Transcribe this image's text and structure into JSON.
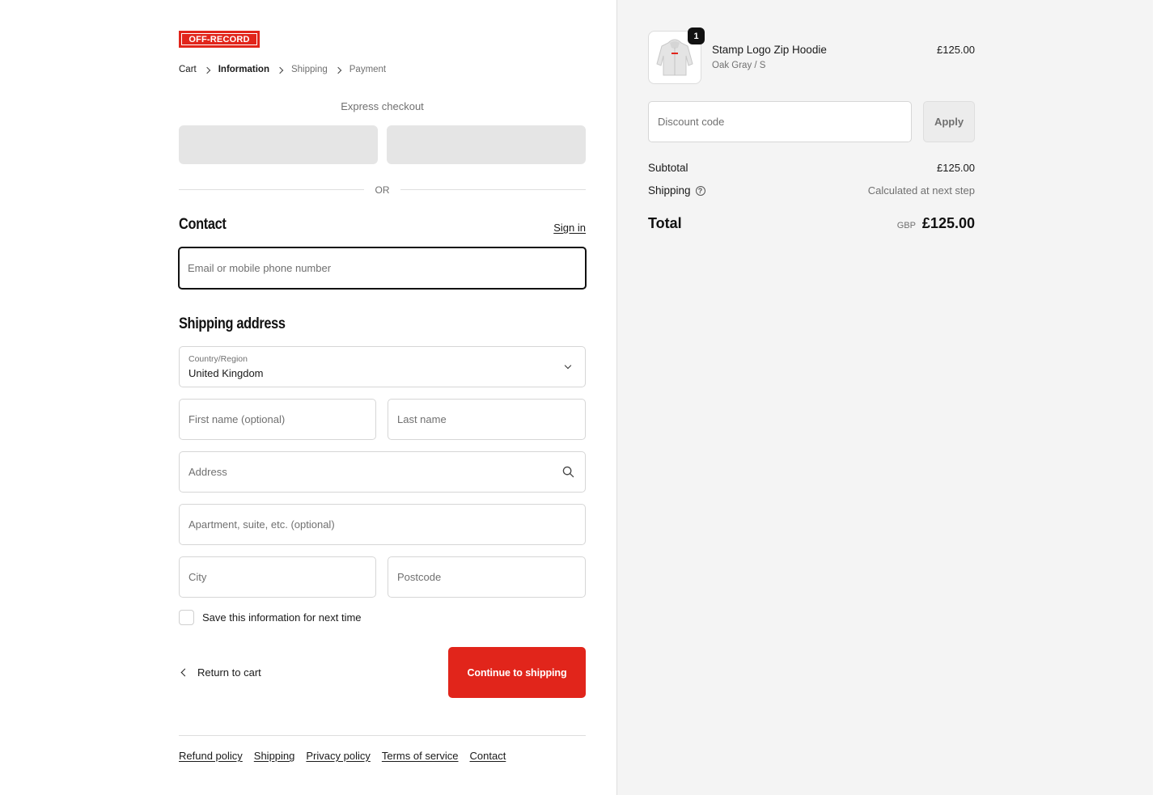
{
  "brand": {
    "logo_text": "OFF-RECORD",
    "accent_color": "#e1251b"
  },
  "breadcrumb": {
    "items": [
      {
        "label": "Cart",
        "state": "link"
      },
      {
        "label": "Information",
        "state": "current"
      },
      {
        "label": "Shipping",
        "state": "upcoming"
      },
      {
        "label": "Payment",
        "state": "upcoming"
      }
    ]
  },
  "express": {
    "title": "Express checkout",
    "or_label": "OR"
  },
  "contact": {
    "title": "Contact",
    "signin_label": "Sign in",
    "email_placeholder": "Email or mobile phone number"
  },
  "shipping": {
    "title": "Shipping address",
    "country_label": "Country/Region",
    "country_value": "United Kingdom",
    "first_name_placeholder": "First name (optional)",
    "last_name_placeholder": "Last name",
    "address_placeholder": "Address",
    "apartment_placeholder": "Apartment, suite, etc. (optional)",
    "city_placeholder": "City",
    "postcode_placeholder": "Postcode",
    "save_info_label": "Save this information for next time"
  },
  "actions": {
    "return_label": "Return to cart",
    "continue_label": "Continue to shipping"
  },
  "footer": {
    "links": [
      "Refund policy",
      "Shipping",
      "Privacy policy",
      "Terms of service",
      "Contact"
    ]
  },
  "order": {
    "item": {
      "name": "Stamp Logo Zip Hoodie",
      "variant": "Oak Gray / S",
      "price": "£125.00",
      "quantity": "1"
    },
    "discount_placeholder": "Discount code",
    "apply_label": "Apply",
    "subtotal_label": "Subtotal",
    "subtotal_value": "£125.00",
    "shipping_label": "Shipping",
    "shipping_value": "Calculated at next step",
    "total_label": "Total",
    "currency": "GBP",
    "total_value": "£125.00"
  }
}
